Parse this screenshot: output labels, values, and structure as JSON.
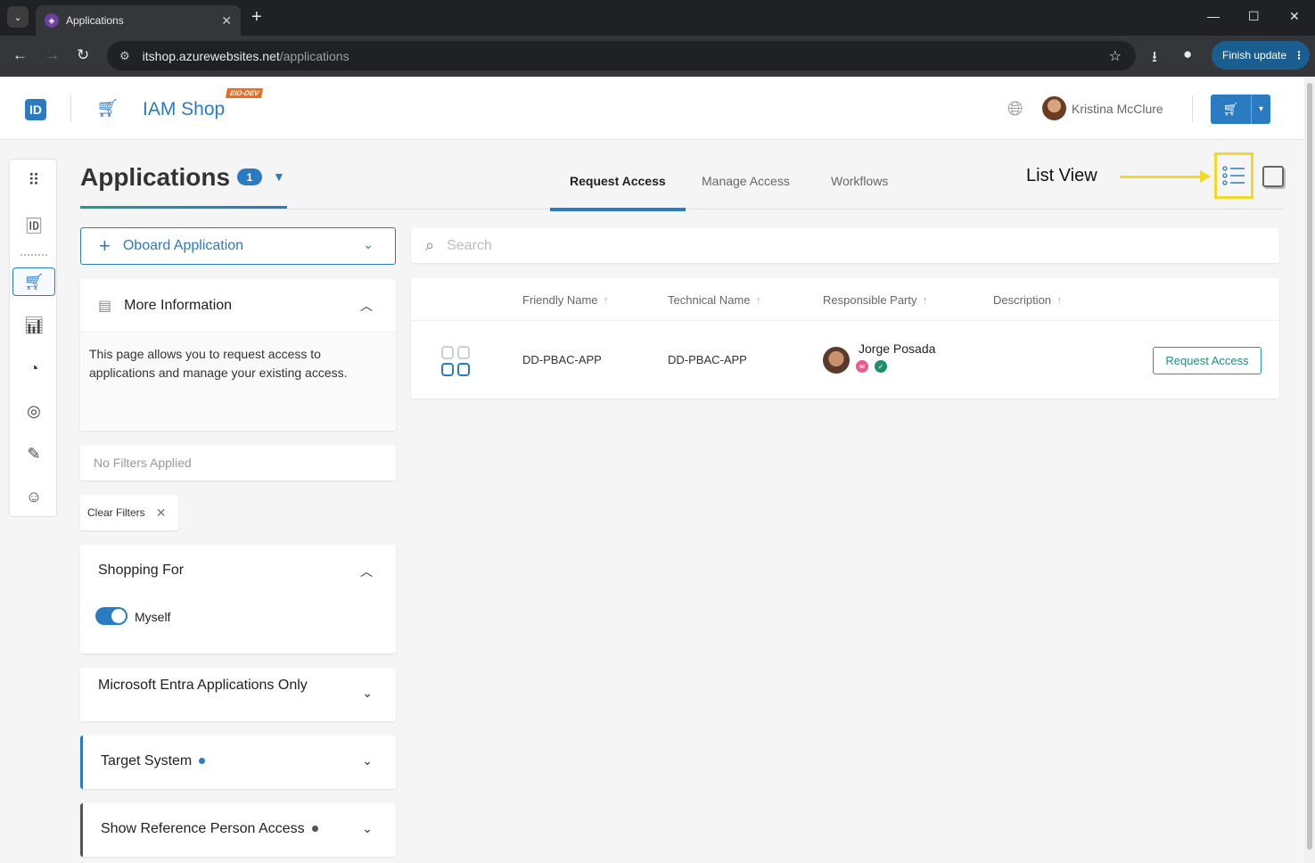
{
  "browser": {
    "tab_title": "Applications",
    "url_host": "itshop.azurewebsites.net",
    "url_path": "/applications",
    "finish_update": "Finish update"
  },
  "header": {
    "shop_title": "IAM Shop",
    "env_badge": "EID-DEV",
    "user_name": "Kristina McClure"
  },
  "page": {
    "title": "Applications",
    "count": "1",
    "tabs": [
      {
        "label": "Request Access",
        "active": true
      },
      {
        "label": "Manage Access",
        "active": false
      },
      {
        "label": "Workflows",
        "active": false
      }
    ],
    "annotation_label": "List View"
  },
  "left_panel": {
    "onboard_label": "Oboard Application",
    "more_info_title": "More Information",
    "more_info_text": "This page allows you to request access to applications and manage your existing access.",
    "no_filters": "No Filters Applied",
    "clear_filters": "Clear Filters",
    "shopping_for_title": "Shopping For",
    "shopping_for_option": "Myself",
    "shopping_for_on": true,
    "entra_title": "Microsoft Entra Applications Only",
    "target_system_title": "Target System",
    "reference_person_title": "Show Reference Person Access"
  },
  "search": {
    "placeholder": "Search"
  },
  "table": {
    "columns": [
      "Friendly Name",
      "Technical Name",
      "Responsible Party",
      "Description"
    ],
    "rows": [
      {
        "friendly_name": "DD-PBAC-APP",
        "technical_name": "DD-PBAC-APP",
        "responsible_party": "Jorge Posada",
        "description": "",
        "action": "Request Access"
      }
    ]
  },
  "colors": {
    "primary": "#2b7bc2",
    "accent_teal": "#1aa08c",
    "highlight_yellow": "#f0d92a",
    "env_badge": "#f26a1b"
  }
}
